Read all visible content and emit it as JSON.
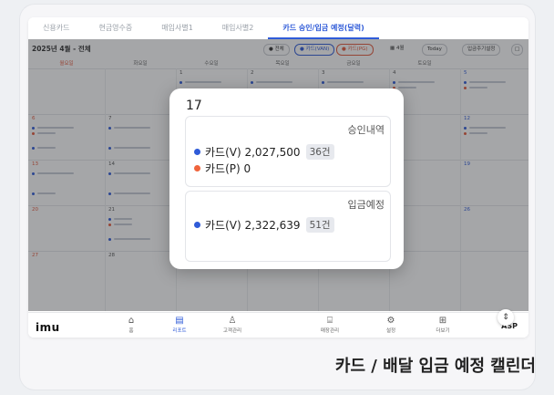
{
  "tabs": [
    {
      "label": "신용카드",
      "active": false
    },
    {
      "label": "현금영수증",
      "active": false
    },
    {
      "label": "매입사별1",
      "active": false
    },
    {
      "label": "매입사별2",
      "active": false
    },
    {
      "label": "카드 승인/입금 예정(달력)",
      "active": true
    }
  ],
  "toolbar": {
    "month_title": "2025년 4월 - 전체",
    "filter_all": "전체",
    "filter_van": "카드(VAN)",
    "filter_pg": "카드(PG)",
    "month_label": "4월",
    "today": "Today",
    "deposit_cycle": "입금주기설정"
  },
  "weekdays": [
    "월요일",
    "화요일",
    "수요일",
    "목요일",
    "금요일",
    "토요일"
  ],
  "week_dates": [
    [
      "",
      "",
      "1",
      "2",
      "3",
      "4",
      "5"
    ],
    [
      "6",
      "7",
      "",
      "",
      "",
      "",
      "12"
    ],
    [
      "13",
      "14",
      "",
      "",
      "",
      "",
      "19"
    ],
    [
      "20",
      "21",
      "",
      "",
      "",
      "",
      "26"
    ],
    [
      "27",
      "28",
      "",
      "",
      "",
      "",
      ""
    ]
  ],
  "popup": {
    "day": "17",
    "approval": {
      "title": "승인내역",
      "rows": [
        {
          "label": "카드(V)",
          "amount": "2,027,500",
          "count": "36건",
          "color": "#2f5bd8"
        },
        {
          "label": "카드(P)",
          "amount": "0",
          "count": "",
          "color": "#f0643c"
        }
      ]
    },
    "deposit": {
      "title": "입금예정",
      "rows": [
        {
          "label": "카드(V)",
          "amount": "2,322,639",
          "count": "51건",
          "color": "#2f5bd8"
        }
      ]
    }
  },
  "bottom_nav": {
    "logo": "imu",
    "items": [
      {
        "label": "홈",
        "icon": "home-icon",
        "active": false
      },
      {
        "label": "리포트",
        "icon": "report-icon",
        "active": true
      },
      {
        "label": "고객관리",
        "icon": "user-icon",
        "active": false
      },
      {
        "label": "매장관리",
        "icon": "store-icon",
        "active": false
      },
      {
        "label": "설정",
        "icon": "gear-icon",
        "active": false
      },
      {
        "label": "더보기",
        "icon": "more-icon",
        "active": false
      }
    ],
    "asp": "ASP"
  },
  "caption": "카드 / 배달 입금 예정 캘린더",
  "colors": {
    "accent": "#2f5bd8",
    "pg": "#e4583b"
  }
}
